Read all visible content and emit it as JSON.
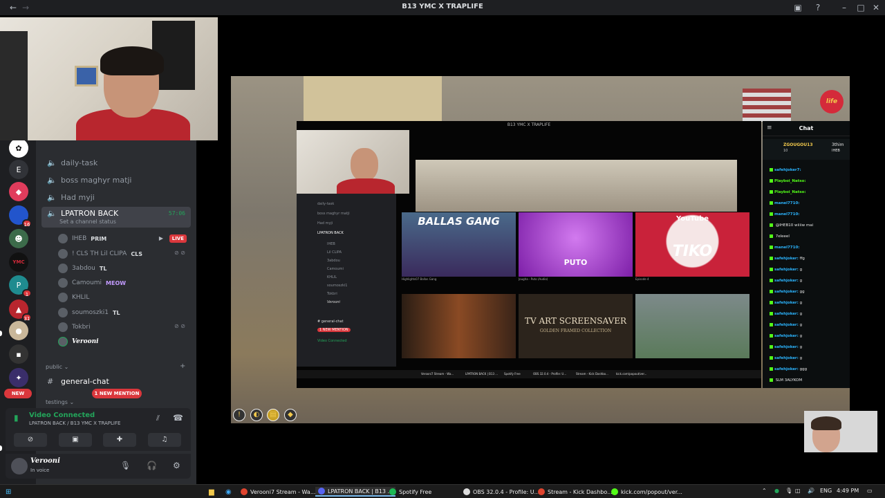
{
  "window": {
    "title": "B13 YMC X TRAPLIFE"
  },
  "rail": {
    "servers": [
      {
        "label": "E"
      },
      {
        "badge": "16"
      },
      {
        "badge": "1"
      },
      {
        "badge": "31"
      }
    ],
    "new_pill": "NEW"
  },
  "channels": {
    "text_items": [
      "daily-task",
      "boss maghyr matji",
      "Had myji"
    ],
    "active": {
      "name": "LPATRON BACK",
      "timer": "57:06",
      "status_placeholder": "Set a channel status"
    },
    "voice_users": [
      {
        "name": "IHEB",
        "tag": "PRIM",
        "live": "LIVE"
      },
      {
        "name": "! CLS TH Lil CLIPA",
        "tag": "CLS"
      },
      {
        "name": "3abdou",
        "tag": "TL"
      },
      {
        "name": "Camoumi",
        "tag": "MEOW"
      },
      {
        "name": "KHLIL",
        "tag": ""
      },
      {
        "name": "soumoszki1",
        "tag": "TL"
      },
      {
        "name": "Tokbri",
        "tag": ""
      },
      {
        "name": "Verooni",
        "tag": ""
      }
    ],
    "category_public": "public",
    "general_chat": "general-chat",
    "new_mention": "1 NEW MENTION",
    "category_testings": "testings"
  },
  "voice_status": {
    "title": "Video Connected",
    "subtitle": "LPATRON BACK / B13 YMC X TRAPLIFE"
  },
  "user_panel": {
    "name": "Verooni",
    "status": "In voice"
  },
  "stream": {
    "logo_text": "life",
    "nested_title": "B13 YMC X TRAPLIFE",
    "nested_sidebar": [
      "daily-task",
      "boss maghyr matji",
      "Had myji",
      "LPATRON BACK",
      "IHEB",
      "Lil CLIPA",
      "3abdou",
      "Camoumi",
      "KHLIL",
      "soumoszki1",
      "Tokbri",
      "Verooni",
      "# general-chat",
      "1 NEW MENTION",
      "Video Connected"
    ],
    "thumbs": [
      {
        "title": "BALLAS GANG",
        "caption": "Highlights07 Ballas Gang",
        "bg": "#3a2a5c"
      },
      {
        "title": "PUTO",
        "caption": "Jougha - Puto (Audio)",
        "bg": "#9c2fc4"
      },
      {
        "title": "TIKO",
        "badge": "YouTube",
        "caption": "Episode 4",
        "bg": "#c9223a"
      },
      {
        "title": "",
        "caption": "",
        "bg": "#6a3a1c"
      },
      {
        "title": "TV ART SCREENSAVER",
        "subtitle": "GOLDEN FRAMED COLLECTION",
        "caption": "",
        "bg": "#3a2e24"
      },
      {
        "title": "",
        "caption": "",
        "bg": "#6f8a7a"
      }
    ],
    "nested_taskbar": [
      "Verooni7 Stream - Wa...",
      "LPATRON BACK | B13 ...",
      "Spotify Free",
      "OBS 32.0.4 - Profile: U...",
      "Stream - Kick Dashbo...",
      "kick.com/popout/ver..."
    ]
  },
  "chat": {
    "header": "Chat",
    "pinned": {
      "user": "ZGOUGOU13",
      "count": "10",
      "extra": "3thim",
      "extra2": "IHEB"
    },
    "messages": [
      {
        "user": "safehjoker7:",
        "text": "",
        "color": "#2cb5ff"
      },
      {
        "user": "Playboi_Natso:",
        "text": "",
        "color": "#53fc18"
      },
      {
        "user": "Playboi_Natso:",
        "text": "",
        "color": "#53fc18"
      },
      {
        "user": "manel7710:",
        "text": "",
        "color": "#2cb5ff"
      },
      {
        "user": "manel7710:",
        "text": "",
        "color": "#2cb5ff"
      },
      {
        "user": "",
        "text": "@IHEB10 wiiiiw mai",
        "color": "#ff4b4b"
      },
      {
        "user": "",
        "text": "7eleeel",
        "color": "#ff4b4b"
      },
      {
        "user": "manel7710:",
        "text": "",
        "color": "#2cb5ff"
      },
      {
        "user": "safehjoker:",
        "text": "ffg",
        "color": "#2cb5ff"
      },
      {
        "user": "safehjoker:",
        "text": "g",
        "color": "#2cb5ff"
      },
      {
        "user": "safehjoker:",
        "text": "g",
        "color": "#2cb5ff"
      },
      {
        "user": "safehjoker:",
        "text": "gg",
        "color": "#2cb5ff"
      },
      {
        "user": "safehjoker:",
        "text": "g",
        "color": "#2cb5ff"
      },
      {
        "user": "safehjoker:",
        "text": "g",
        "color": "#2cb5ff"
      },
      {
        "user": "safehjoker:",
        "text": "g",
        "color": "#2cb5ff"
      },
      {
        "user": "safehjoker:",
        "text": "g",
        "color": "#2cb5ff"
      },
      {
        "user": "safehjoker:",
        "text": "g",
        "color": "#2cb5ff"
      },
      {
        "user": "safehjoker:",
        "text": "g",
        "color": "#2cb5ff"
      },
      {
        "user": "safehjoker:",
        "text": "ggg",
        "color": "#2cb5ff"
      },
      {
        "user": "",
        "text": "SLM 3ALYKOM",
        "color": "#ff4b4b"
      }
    ]
  },
  "taskbar": {
    "items": [
      {
        "label": "Verooni7 Stream - Wa...",
        "icon_color": "#e0452f"
      },
      {
        "label": "LPATRON BACK | B13 ...",
        "icon_color": "#5865f2"
      },
      {
        "label": "Spotify Free",
        "icon_color": "#1db954"
      },
      {
        "label": "OBS 32.0.4 - Profile: U...",
        "icon_color": "#dddddd"
      },
      {
        "label": "Stream - Kick Dashbo...",
        "icon_color": "#e0452f"
      },
      {
        "label": "kick.com/popout/ver...",
        "icon_color": "#53fc18"
      }
    ],
    "lang": "ENG",
    "time": "4:49 PM"
  }
}
